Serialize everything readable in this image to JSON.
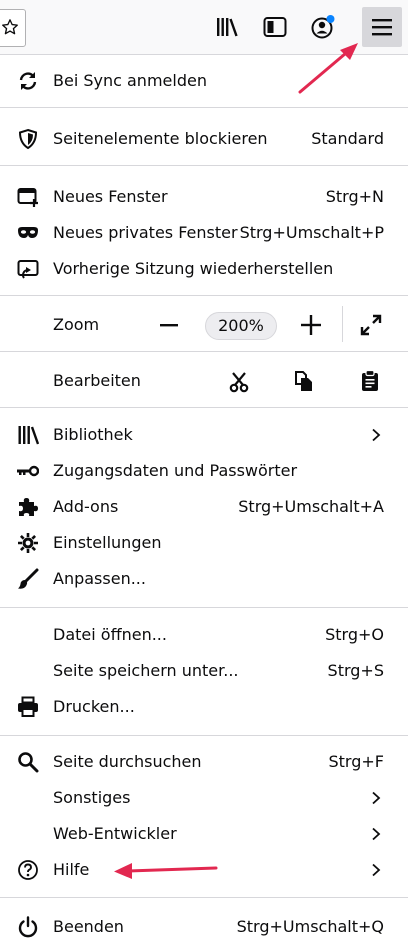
{
  "colors": {
    "accent_dot": "#0a84ff",
    "arrow": "#e22850",
    "menu_button_bg": "#d7d7db"
  },
  "toolbar": {
    "icons": [
      "bookmark-star-icon",
      "library-icon",
      "sidebar-icon",
      "account-icon",
      "hamburger-menu-icon"
    ]
  },
  "menu": {
    "sync": {
      "label": "Bei Sync anmelden"
    },
    "tracking": {
      "label": "Seitenelemente blockieren",
      "value": "Standard"
    },
    "new_window": {
      "label": "Neues Fenster",
      "accel": "Strg+N"
    },
    "private_window": {
      "label": "Neues privates Fenster",
      "accel": "Strg+Umschalt+P"
    },
    "restore_session": {
      "label": "Vorherige Sitzung wiederherstellen"
    },
    "zoom": {
      "label": "Zoom",
      "value": "200%"
    },
    "edit": {
      "label": "Bearbeiten"
    },
    "library": {
      "label": "Bibliothek"
    },
    "logins": {
      "label": "Zugangsdaten und Passwörter"
    },
    "addons": {
      "label": "Add-ons",
      "accel": "Strg+Umschalt+A"
    },
    "settings": {
      "label": "Einstellungen"
    },
    "customize": {
      "label": "Anpassen..."
    },
    "open_file": {
      "label": "Datei öffnen...",
      "accel": "Strg+O"
    },
    "save_page": {
      "label": "Seite speichern unter...",
      "accel": "Strg+S"
    },
    "print": {
      "label": "Drucken..."
    },
    "find": {
      "label": "Seite durchsuchen",
      "accel": "Strg+F"
    },
    "more": {
      "label": "Sonstiges"
    },
    "web_developer": {
      "label": "Web-Entwickler"
    },
    "help": {
      "label": "Hilfe"
    },
    "quit": {
      "label": "Beenden",
      "accel": "Strg+Umschalt+Q"
    }
  }
}
